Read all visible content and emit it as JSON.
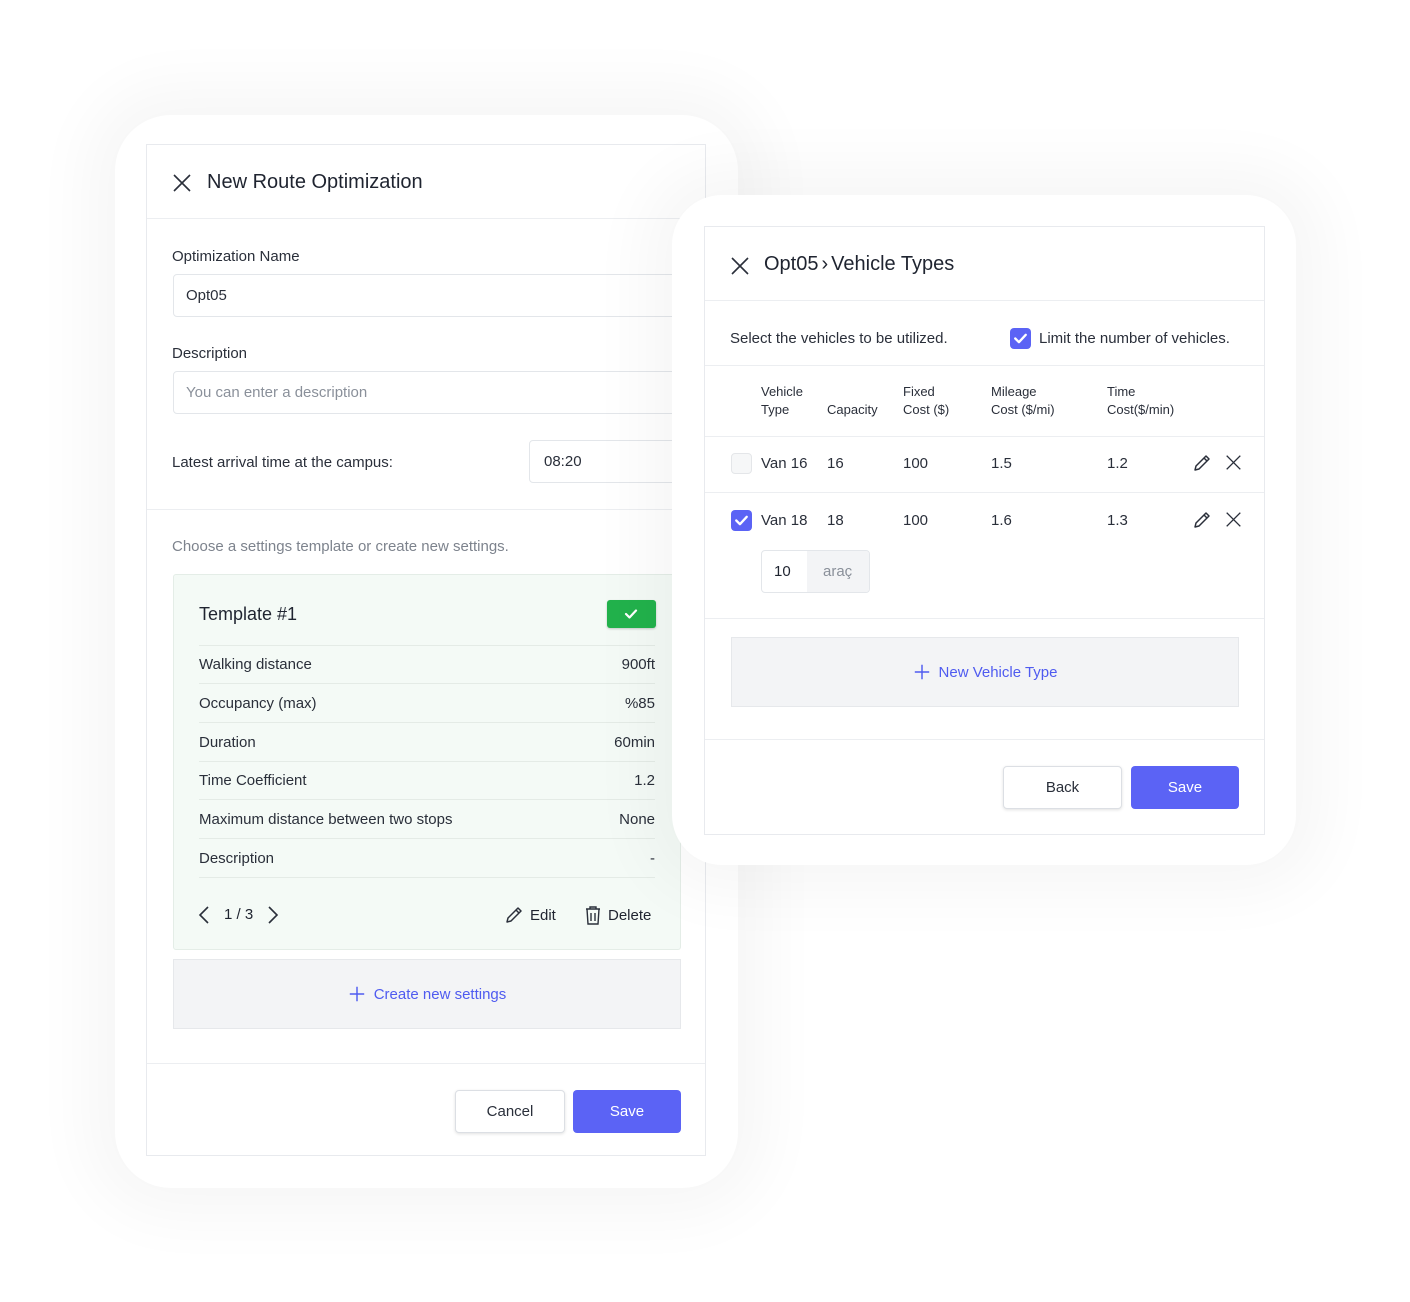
{
  "left_dialog": {
    "title": "New Route Optimization",
    "name_label": "Optimization Name",
    "name_value": "Opt05",
    "description_label": "Description",
    "description_placeholder": "You can enter a description",
    "arrival_label": "Latest arrival time at the campus:",
    "arrival_value": "08:20",
    "template_hint": "Choose a settings template or create new settings.",
    "template": {
      "title": "Template #1",
      "selected": true,
      "rows": [
        {
          "label": "Walking distance",
          "value": "900ft"
        },
        {
          "label": "Occupancy (max)",
          "value": "%85"
        },
        {
          "label": "Duration",
          "value": "60min"
        },
        {
          "label": "Time Coefficient",
          "value": "1.2"
        },
        {
          "label": "Maximum distance between two stops",
          "value": "None"
        },
        {
          "label": "Description",
          "value": "-"
        }
      ],
      "pager": "1 / 3",
      "edit_label": "Edit",
      "delete_label": "Delete"
    },
    "create_label": "Create new settings",
    "cancel_label": "Cancel",
    "save_label": "Save"
  },
  "right_dialog": {
    "title_prefix": "Opt05",
    "title_sep": "›",
    "title": "Vehicle Types",
    "select_hint": "Select the vehicles to be utilized.",
    "limit_label": "Limit the number of vehicles.",
    "limit_checked": true,
    "columns": [
      {
        "line1": "Vehicle",
        "line2": "Type"
      },
      {
        "line1": "",
        "line2": "Capacity"
      },
      {
        "line1": "Fixed",
        "line2": "Cost ($)"
      },
      {
        "line1": "Mileage",
        "line2": "Cost ($/mi)"
      },
      {
        "line1": "Time",
        "line2": "Cost($/min)"
      }
    ],
    "vehicles": [
      {
        "type": "Van 16",
        "capacity": "16",
        "fixed": "100",
        "mileage": "1.5",
        "time": "1.2",
        "checked": false
      },
      {
        "type": "Van 18",
        "capacity": "18",
        "fixed": "100",
        "mileage": "1.6",
        "time": "1.3",
        "checked": true,
        "count": "10",
        "count_unit": "araç"
      }
    ],
    "new_vehicle_label": "New Vehicle Type",
    "back_label": "Back",
    "save_label": "Save"
  },
  "colors": {
    "primary": "#5b63f5",
    "success": "#22b24c",
    "link": "#4f5bf0"
  }
}
